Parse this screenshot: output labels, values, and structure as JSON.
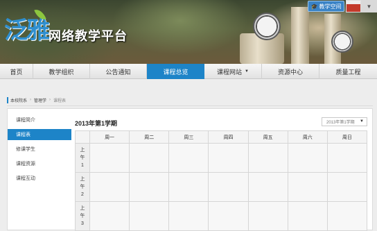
{
  "header": {
    "logo_mark": "泛雅",
    "logo_text": "网络教学平台",
    "space_button": "教学空间",
    "avatar_dropdown": "▼"
  },
  "nav": {
    "items": [
      {
        "label": "首页",
        "active": false
      },
      {
        "label": "教学组织",
        "active": false
      },
      {
        "label": "公告通知",
        "active": false
      },
      {
        "label": "课程总览",
        "active": true
      },
      {
        "label": "课程网站",
        "active": false,
        "has_menu": true
      },
      {
        "label": "资源中心",
        "active": false
      },
      {
        "label": "质量工程",
        "active": false
      }
    ]
  },
  "breadcrumb": {
    "items": [
      "本校院系",
      "管理学",
      "课程表"
    ]
  },
  "sidebar": {
    "items": [
      {
        "label": "课程简介",
        "active": false
      },
      {
        "label": "课程表",
        "active": true
      },
      {
        "label": "修课学生",
        "active": false
      },
      {
        "label": "课程资源",
        "active": false
      },
      {
        "label": "课程互动",
        "active": false
      }
    ]
  },
  "main": {
    "term_title": "2013年第1学期",
    "term_select": "2013年第1学期",
    "schedule": {
      "days": [
        "周一",
        "周二",
        "周三",
        "周四",
        "周五",
        "周六",
        "周日"
      ],
      "periods": [
        "上午1",
        "上午2",
        "上午3"
      ]
    }
  },
  "colors": {
    "accent": "#1d84c8",
    "nav_bg": "#eeeeee",
    "page_bg": "#ededed"
  }
}
